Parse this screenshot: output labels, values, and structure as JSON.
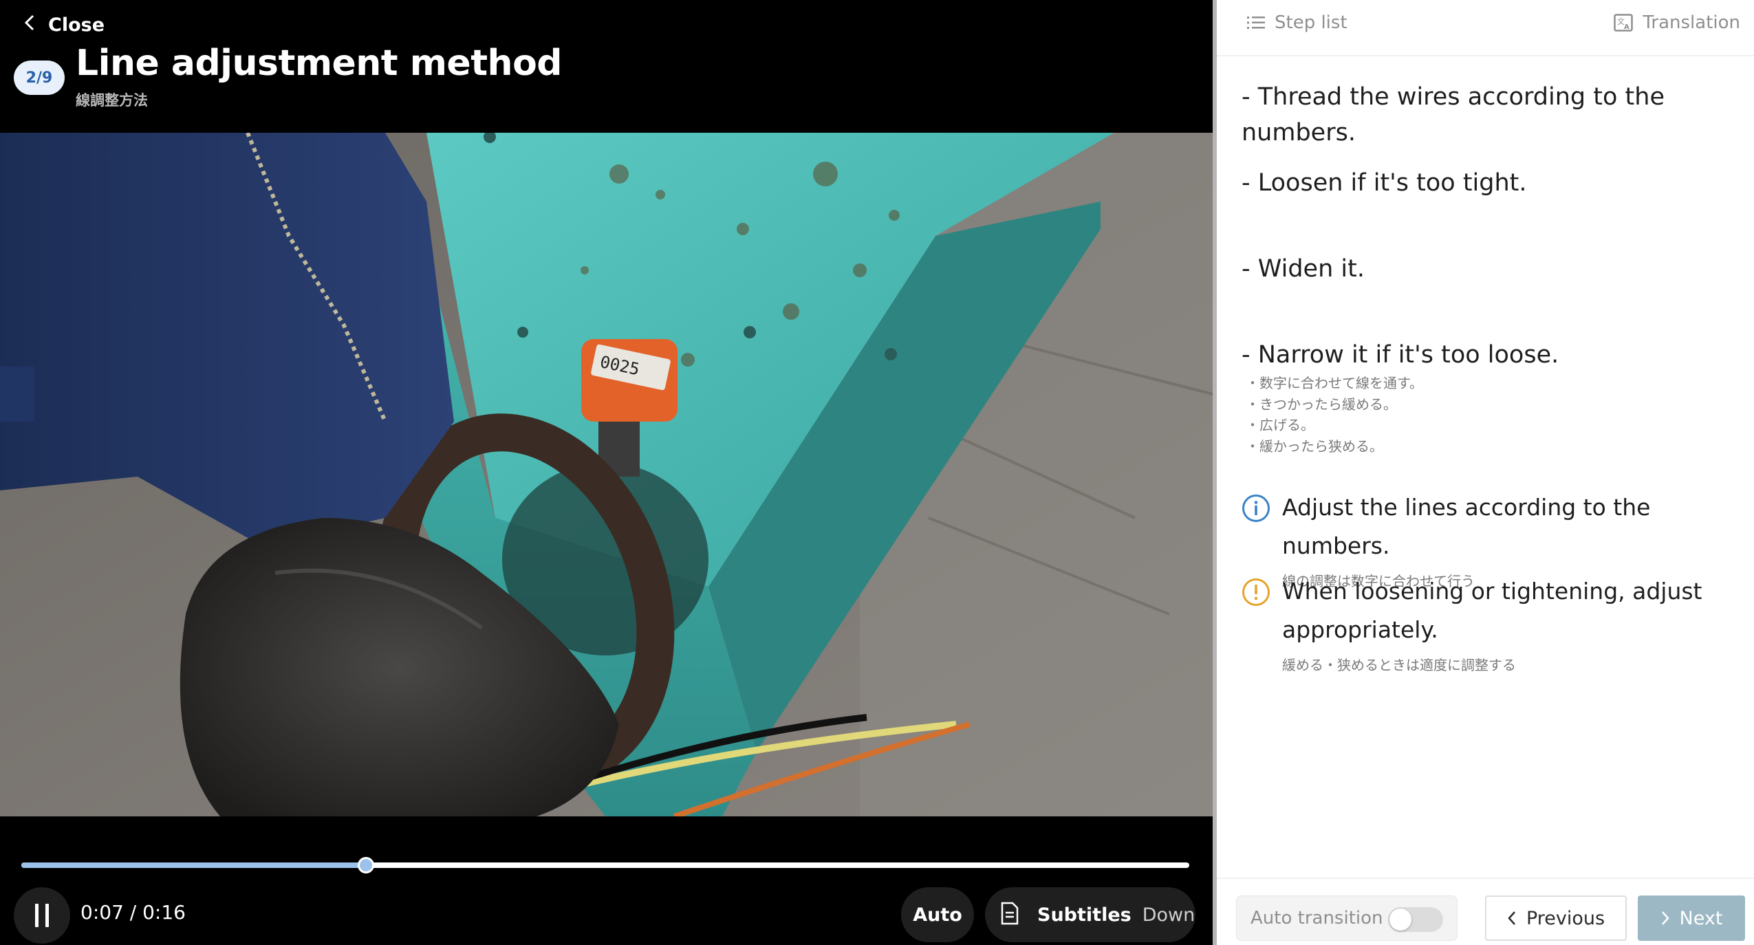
{
  "player": {
    "close_label": "Close",
    "step_badge": "2/9",
    "title": "Line adjustment method",
    "subtitle": "線調整方法",
    "progress_fraction": 0.295,
    "time": "0:07 / 0:16",
    "auto_label": "Auto",
    "subtitles_label": "Subtitles",
    "subtitles_value": "Down"
  },
  "panel": {
    "step_list_label": "Step list",
    "translation_label": "Translation",
    "instructions": [
      "- Thread the wires according to the numbers.",
      "- Loosen if it's too tight.",
      "- Widen it.",
      "- Narrow it if it's too loose."
    ],
    "original_lines": [
      "・数字に合わせて線を通す。",
      "・きつかったら緩める。",
      "・広げる。",
      "・緩かったら狭める。"
    ],
    "info_note": {
      "text": "Adjust the lines according to the numbers.",
      "sub": "線の調整は数字に合わせて行う"
    },
    "warning_note": {
      "text": "When loosening or tightening, adjust appropriately.",
      "sub": "緩める・狭めるときは適度に調整する"
    }
  },
  "footer": {
    "auto_transition_label": "Auto transition",
    "auto_transition_on": false,
    "previous_label": "Previous",
    "next_label": "Next"
  },
  "colors": {
    "badge_bg": "#e8f1fb",
    "badge_text": "#2a61a8",
    "progress": "#9cc1ea",
    "info_icon": "#3b82c8",
    "warning_icon": "#e4a52a",
    "next_button": "#9bb8c4"
  }
}
